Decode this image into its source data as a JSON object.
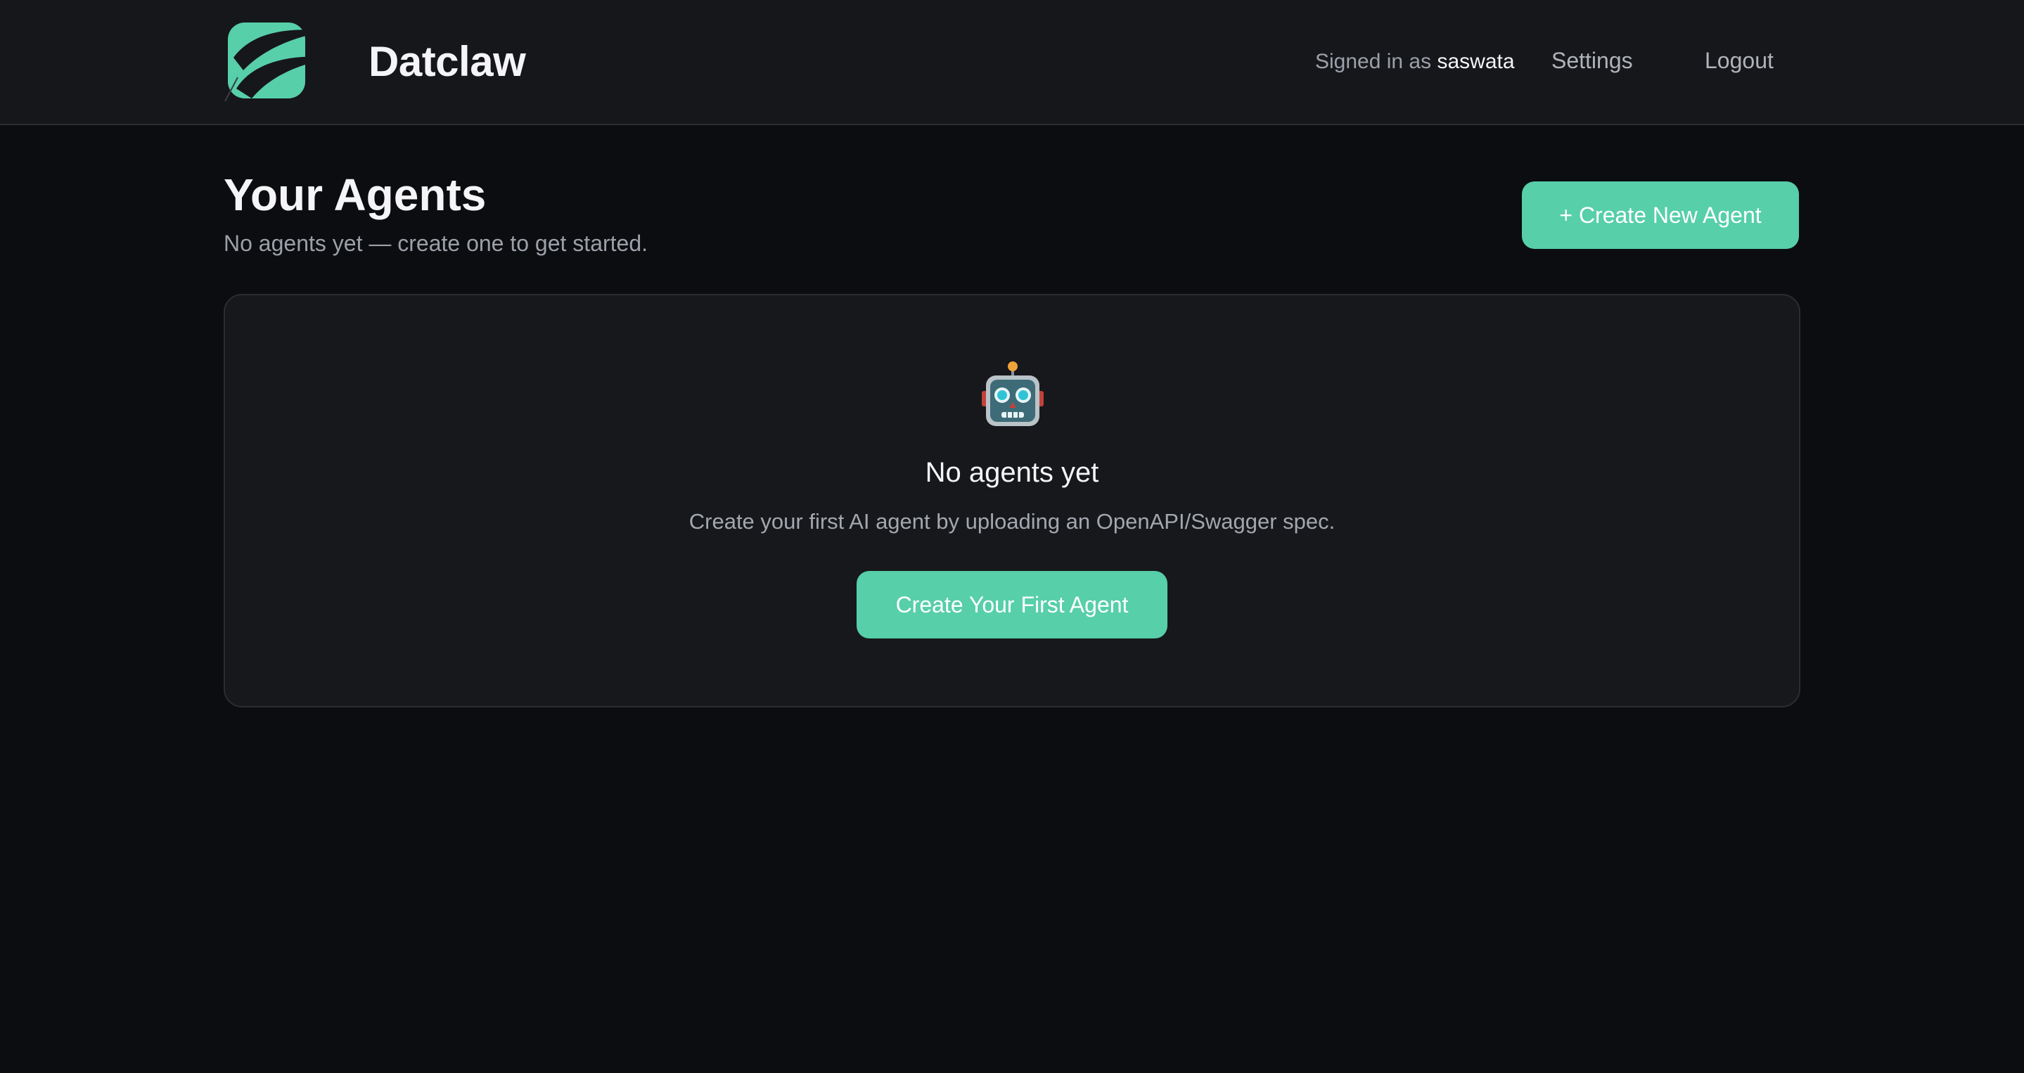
{
  "header": {
    "brand": "Datclaw",
    "signed_in_prefix": "Signed in as",
    "username": "saswata",
    "settings_label": "Settings",
    "logout_label": "Logout"
  },
  "main": {
    "title": "Your Agents",
    "subtitle": "No agents yet — create one to get started.",
    "create_button_label": "+ Create New Agent"
  },
  "empty_state": {
    "icon": "robot-icon",
    "title": "No agents yet",
    "description": "Create your first AI agent by uploading an OpenAPI/Swagger spec.",
    "cta_label": "Create Your First Agent"
  },
  "colors": {
    "accent": "#57cfa8",
    "background": "#0c0d10",
    "header_bg": "#16171b",
    "card_bg": "#17181c"
  }
}
